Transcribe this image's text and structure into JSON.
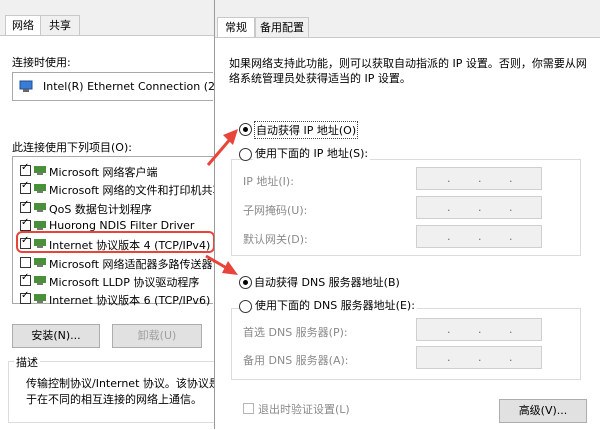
{
  "left_dialog": {
    "tabs": [
      {
        "label": "网络"
      },
      {
        "label": "共享"
      }
    ],
    "connect_using_label": "连接时使用:",
    "adapter_name": "Intel(R) Ethernet Connection (2) I2",
    "items_label": "此连接使用下列项目(O):",
    "items": [
      {
        "label": "Microsoft 网络客户端",
        "checked": true
      },
      {
        "label": "Microsoft 网络的文件和打印机共享",
        "checked": true
      },
      {
        "label": "QoS 数据包计划程序",
        "checked": true
      },
      {
        "label": "Huorong NDIS Filter Driver",
        "checked": true
      },
      {
        "label": "Internet 协议版本 4 (TCP/IPv4)",
        "checked": true
      },
      {
        "label": "Microsoft 网络适配器多路传送器协",
        "checked": false
      },
      {
        "label": "Microsoft LLDP 协议驱动程序",
        "checked": true
      },
      {
        "label": "Internet 协议版本 6 (TCP/IPv6)",
        "checked": true
      }
    ],
    "install_button": "安装(N)...",
    "uninstall_button": "卸载(U)",
    "description_title": "描述",
    "description_line1": "传输控制协议/Internet 协议。该协议是",
    "description_line2": "于在不同的相互连接的网络上通信。"
  },
  "right_dialog": {
    "tabs": [
      {
        "label": "常规"
      },
      {
        "label": "备用配置"
      }
    ],
    "intro_line1": "如果网络支持此功能，则可以获取自动指派的 IP 设置。否则，你需要从网",
    "intro_line2": "络系统管理员处获得适当的 IP 设置。",
    "auto_ip_label": "自动获得 IP 地址(O)",
    "manual_ip_label": "使用下面的 IP 地址(S):",
    "ip_address_label": "IP 地址(I):",
    "subnet_label": "子网掩码(U):",
    "gateway_label": "默认网关(D):",
    "auto_dns_label": "自动获得 DNS 服务器地址(B)",
    "manual_dns_label": "使用下面的 DNS 服务器地址(E):",
    "preferred_dns_label": "首选 DNS 服务器(P):",
    "alternate_dns_label": "备用 DNS 服务器(A):",
    "validate_label": "退出时验证设置(L)",
    "advanced_button": "高级(V)...",
    "ip_dot": "."
  },
  "colors": {
    "annotation_red": "#e8443a"
  },
  "icons": [
    "network-adapter-icon",
    "network-component-icon",
    "red-arrow-icon"
  ]
}
